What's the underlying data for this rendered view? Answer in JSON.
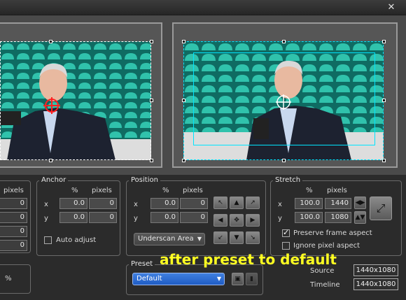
{
  "window": {
    "close_glyph": "✕"
  },
  "stretch_left": {
    "header_pixels": "pixels",
    "values": [
      "0",
      "0",
      "0",
      "0"
    ]
  },
  "anchor": {
    "title": "Anchor",
    "header_pct": "%",
    "header_pixels": "pixels",
    "x_label": "x",
    "y_label": "y",
    "x_pct": "0.0",
    "x_px": "0",
    "y_pct": "0.0",
    "y_px": "0",
    "auto_adjust_label": "Auto adjust",
    "auto_adjust_checked": false
  },
  "position": {
    "title": "Position",
    "header_pct": "%",
    "header_pixels": "pixels",
    "x_label": "x",
    "y_label": "y",
    "x_pct": "0.0",
    "x_px": "0",
    "y_pct": "0.0",
    "y_px": "0",
    "mode_value": "Underscan Area",
    "nudge_icons": [
      "↖",
      "▲",
      "↗",
      "◀",
      "✥",
      "▶",
      "↙",
      "▼",
      "↘"
    ]
  },
  "stretch": {
    "title": "Stretch",
    "header_pct": "%",
    "header_pixels": "pixels",
    "x_label": "x",
    "y_label": "y",
    "x_pct": "100.0",
    "x_px": "1440",
    "y_pct": "100.0",
    "y_px": "1080",
    "preserve_frame_label": "Preserve frame aspect",
    "preserve_frame_checked": true,
    "ignore_pixel_label": "Ignore pixel aspect",
    "ignore_pixel_checked": false
  },
  "preset": {
    "title": "Preset",
    "value": "Default"
  },
  "bottom_left": {
    "unit": "%"
  },
  "info": {
    "source_label": "Source",
    "source_value": "1440x1080",
    "timeline_label": "Timeline",
    "timeline_value": "1440x1080"
  },
  "annotation": {
    "text": "after preset to default"
  },
  "colors": {
    "accent_blue": "#2a6ad8",
    "annotation_yellow": "#ffff22",
    "selection_cyan": "#00e5ff",
    "anchor_red": "#ff2020"
  }
}
